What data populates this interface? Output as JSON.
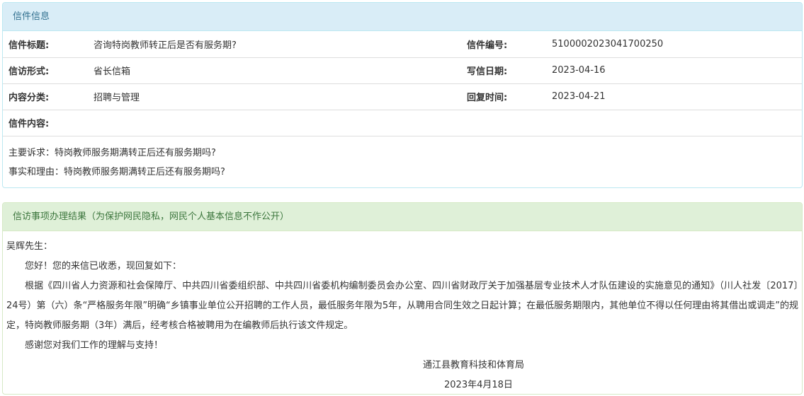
{
  "letter_panel": {
    "title": "信件信息",
    "rows": [
      {
        "label1": "信件标题:",
        "value1": "咨询特岗教师转正后是否有服务期?",
        "label2": "信件编号:",
        "value2": "5100002023041700250"
      },
      {
        "label1": "信访形式:",
        "value1": "省长信箱",
        "label2": "写信日期:",
        "value2": "2023-04-16"
      },
      {
        "label1": "内容分类:",
        "value1": "招聘与管理",
        "label2": "回复时间:",
        "value2": "2023-04-21"
      }
    ],
    "content_label": "信件内容:",
    "content_lines": [
      "主要诉求：特岗教师服务期满转正后还有服务期吗?",
      "事实和理由：特岗教师服务期满转正后还有服务期吗?"
    ]
  },
  "result_panel": {
    "title": "信访事项办理结果（为保护网民隐私，网民个人基本信息不作公开）",
    "salutation": "吴辉先生：",
    "greeting": "您好！您的来信已收悉，现回复如下：",
    "body": "根据《四川省人力资源和社会保障厅、中共四川省委组织部、中共四川省委机构编制委员会办公室、四川省财政厅关于加强基层专业技术人才队伍建设的实施意见的通知》（川人社发〔2017〕24号）第（六）条“严格服务年限”明确“乡镇事业单位公开招聘的工作人员，最低服务年限为5年，从聘用合同生效之日起计算；在最低服务期限内，其他单位不得以任何理由将其借出或调走”的规定，特岗教师服务期（3年）满后，经考核合格被聘用为在编教师后执行该文件规定。",
    "thanks": "感谢您对我们工作的理解与支持！",
    "signature": "通江县教育科技和体育局",
    "date": "2023年4月18日"
  }
}
